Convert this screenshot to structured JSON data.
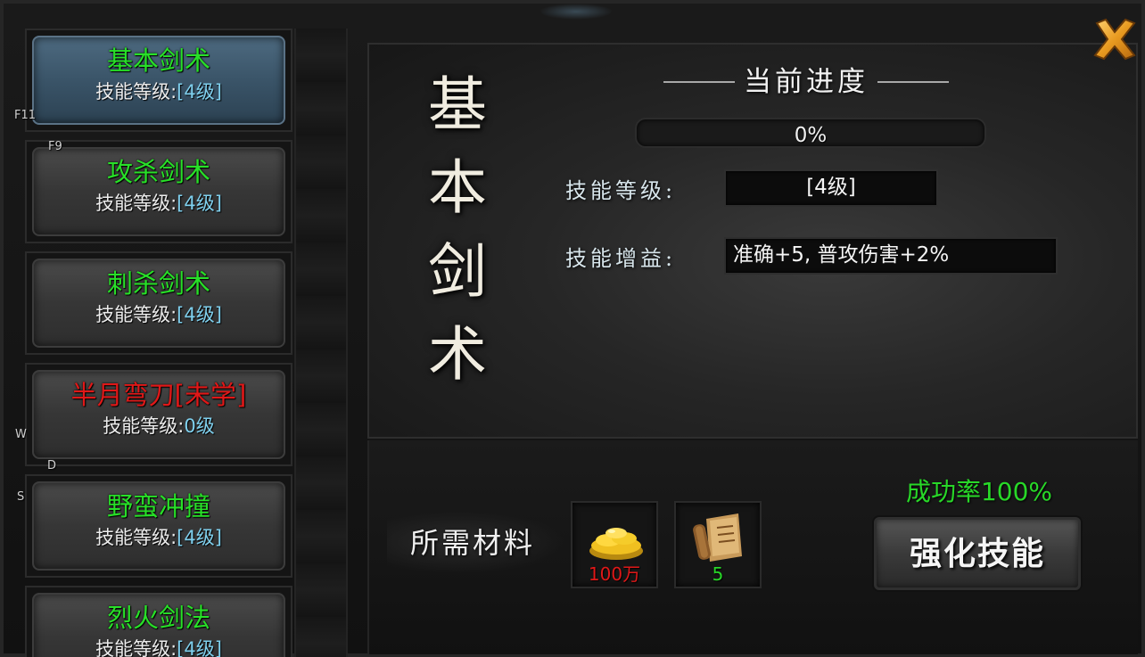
{
  "skills": [
    {
      "name": "基本剑术",
      "level_label": "技能等级:",
      "level_value": "[4级]",
      "selected": true,
      "learned": true
    },
    {
      "name": "攻杀剑术",
      "level_label": "技能等级:",
      "level_value": "[4级]",
      "selected": false,
      "learned": true
    },
    {
      "name": "刺杀剑术",
      "level_label": "技能等级:",
      "level_value": "[4级]",
      "selected": false,
      "learned": true
    },
    {
      "name": "半月弯刀[未学]",
      "level_label": "技能等级:",
      "level_value": "0级",
      "selected": false,
      "learned": false
    },
    {
      "name": "野蛮冲撞",
      "level_label": "技能等级:",
      "level_value": "[4级]",
      "selected": false,
      "learned": true
    },
    {
      "name": "烈火剑法",
      "level_label": "技能等级:",
      "level_value": "[4级]",
      "selected": false,
      "learned": true
    }
  ],
  "key_hints": [
    "F11",
    "F9",
    "W",
    "D",
    "S"
  ],
  "detail": {
    "title_chars": [
      "基",
      "本",
      "剑",
      "术"
    ],
    "progress_title": "当前进度",
    "progress_text": "0%",
    "progress_value": 0,
    "level_label": "技能等级:",
    "level_value": "[4级]",
    "bonus_label": "技能增益:",
    "bonus_value": "准确+5, 普攻伤害+2%"
  },
  "materials": {
    "label": "所需材料",
    "items": [
      {
        "icon": "gold-coins-icon",
        "quantity": "100万",
        "qty_color": "#e01818"
      },
      {
        "icon": "scroll-icon",
        "quantity": "5",
        "qty_color": "#28d828"
      }
    ]
  },
  "success_rate": "成功率100%",
  "enhance_button": "强化技能",
  "colors": {
    "learned": "#28e028",
    "unlearned": "#e01818",
    "level_value": "#7fd0ee",
    "close_icon": "#e8a020"
  }
}
